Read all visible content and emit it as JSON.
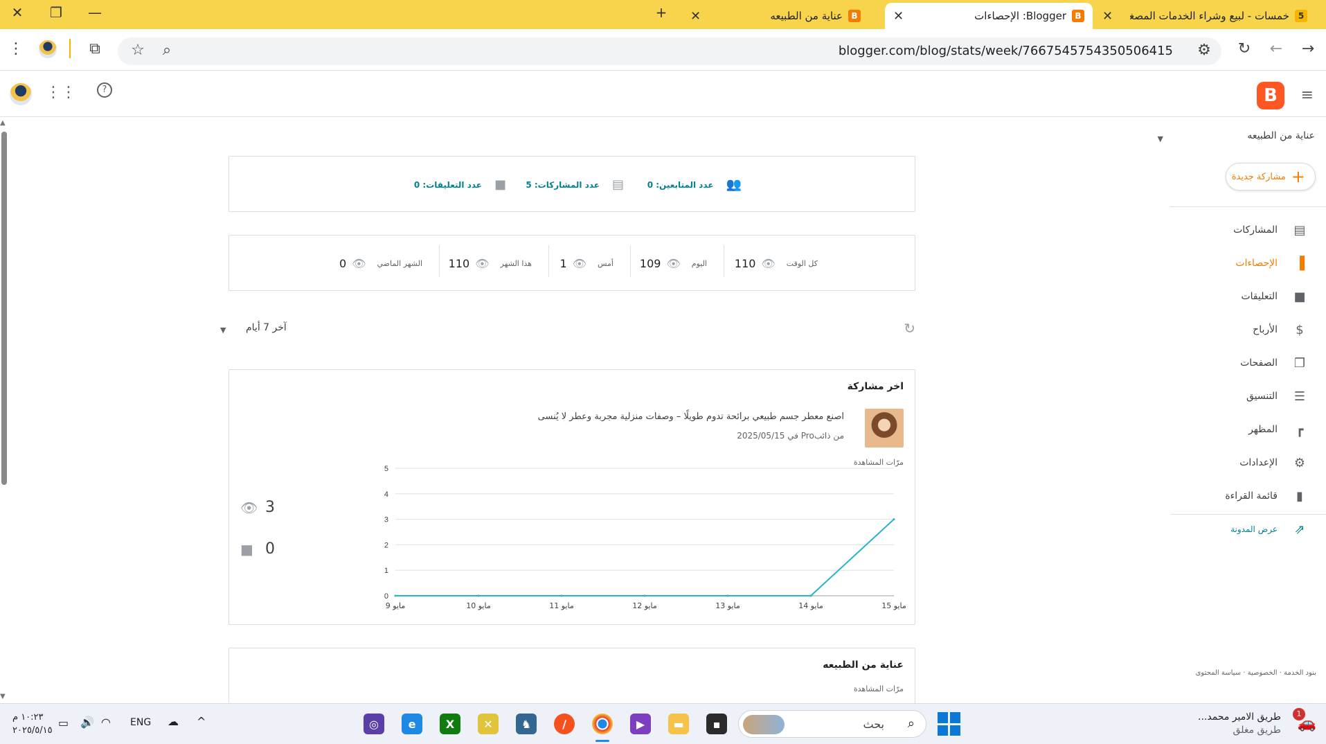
{
  "browser": {
    "tabs": [
      {
        "title": "خمسات - لبيع وشراء الخدمات المصغرة",
        "favicon": "5",
        "active": false
      },
      {
        "title": "Blogger: الإحصاءات",
        "favicon": "B",
        "active": true
      },
      {
        "title": "عناية من الطبيعه",
        "favicon": "B",
        "active": false
      }
    ],
    "url": "blogger.com/blog/stats/week/7667545754350506415"
  },
  "sidebar": {
    "blog_name": "عناية من الطبيعه",
    "new_post_label": "مشاركة جديدة",
    "items": [
      {
        "label": "المشاركات",
        "icon": "posts-icon",
        "active": false
      },
      {
        "label": "الإحصاءات",
        "icon": "stats-icon",
        "active": true
      },
      {
        "label": "التعليقات",
        "icon": "comments-icon",
        "active": false
      },
      {
        "label": "الأرباح",
        "icon": "dollar-icon",
        "active": false
      },
      {
        "label": "الصفحات",
        "icon": "pages-icon",
        "active": false
      },
      {
        "label": "التنسيق",
        "icon": "layout-icon",
        "active": false
      },
      {
        "label": "المظهر",
        "icon": "paint-roller-icon",
        "active": false
      },
      {
        "label": "الإعدادات",
        "icon": "gear-icon",
        "active": false
      },
      {
        "label": "قائمة القراءة",
        "icon": "bookmark-icon",
        "active": false
      }
    ],
    "view_blog_label": "عرض المدونة",
    "footer": [
      "بنود الخدمة",
      "الخصوصية",
      "سياسة المحتوى"
    ]
  },
  "summary": {
    "followers": "عدد المتابعين: 0",
    "posts": "عدد المشاركات: 5",
    "comments": "عدد التعليقات: 0"
  },
  "views": [
    {
      "label": "كل الوقت",
      "value": "110"
    },
    {
      "label": "اليوم",
      "value": "109"
    },
    {
      "label": "أمس",
      "value": "1"
    },
    {
      "label": "هذا الشهر",
      "value": "110"
    },
    {
      "label": "الشهر الماضي",
      "value": "0"
    }
  ],
  "range": {
    "label": "آخر 7 أيام"
  },
  "latest_post": {
    "card_title": "اخر مشاركة",
    "title": "اصنع معطر جسم طبيعي برائحة تدوم طويلًا – وصفات منزلية مجربة وعطر لا يُنسى",
    "meta": "من ذائبPro في 2025/05/15",
    "views_label": "مرّات المشاهدة",
    "views_count": "3",
    "comments_count": "0"
  },
  "chart_data": {
    "type": "line",
    "categories": [
      "مايو 9",
      "مايو 10",
      "مايو 11",
      "مايو 12",
      "مايو 13",
      "مايو 14",
      "مايو 15"
    ],
    "series": [
      {
        "values": [
          0,
          0,
          0,
          0,
          0,
          0,
          3
        ]
      }
    ],
    "y_ticks": [
      "0",
      "1",
      "2",
      "3",
      "4",
      "5"
    ],
    "ylim": [
      0,
      5
    ],
    "grid": true,
    "color": "#26b5c9"
  },
  "blog_card": {
    "title": "عناية من الطبيعه",
    "views_label": "مرّات المشاهدة"
  },
  "taskbar": {
    "search_placeholder": "بحث",
    "time": "١٠:٢٣ م",
    "date": "٢٠٢٥/٥/١٥",
    "language": "ENG",
    "traffic_title": "طريق الامير محمد...",
    "traffic_status": "طريق مغلق",
    "notification_count": "1"
  }
}
